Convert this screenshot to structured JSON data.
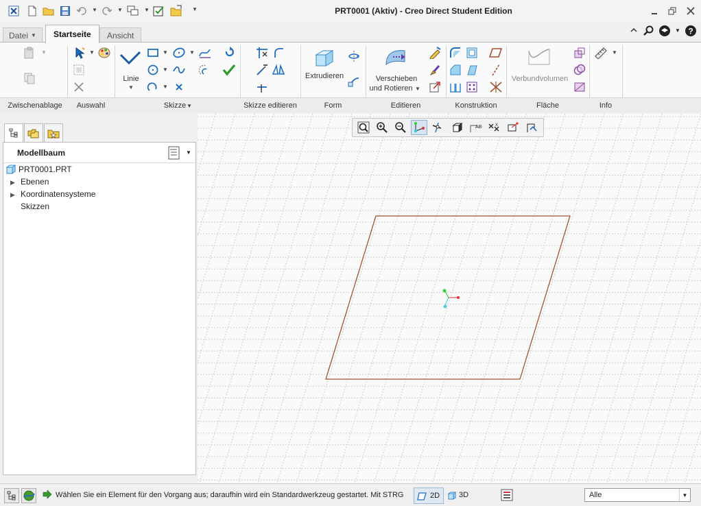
{
  "app": {
    "title": "PRT0001 (Aktiv) - Creo Direct Student Edition"
  },
  "tabs": [
    {
      "label": "Datei"
    },
    {
      "label": "Startseite",
      "active": true
    },
    {
      "label": "Ansicht"
    }
  ],
  "ribbon": {
    "groups": [
      {
        "label": "Zwischenablage"
      },
      {
        "label": "Auswahl"
      },
      {
        "label": "Skizze"
      },
      {
        "label": "Skizze editieren"
      },
      {
        "label": "Form"
      },
      {
        "label": "Editieren"
      },
      {
        "label": "Konstruktion"
      },
      {
        "label": "Fläche"
      },
      {
        "label": "Info"
      }
    ],
    "linie_label": "Linie",
    "extrudieren_label": "Extrudieren",
    "verschieben_label_1": "Verschieben",
    "verschieben_label_2": "und Rotieren",
    "verbundvolumen_label": "Verbundvolumen"
  },
  "left_panel": {
    "title": "Modellbaum",
    "tree": [
      {
        "label": "PRT0001.PRT"
      },
      {
        "label": "Ebenen"
      },
      {
        "label": "Koordinatensysteme"
      },
      {
        "label": "Skizzen"
      }
    ]
  },
  "status": {
    "message": "Wählen Sie ein Element für den Vorgang aus; daraufhin wird ein Standardwerkzeug gestartet. Mit STRG kö",
    "mode_2d": "2D",
    "mode_3d": "3D",
    "filter_value": "Alle"
  },
  "colors": {
    "sketch_plane": "#a0522d",
    "accent_blue": "#1e6fbf",
    "check_green": "#2a9a2a"
  }
}
